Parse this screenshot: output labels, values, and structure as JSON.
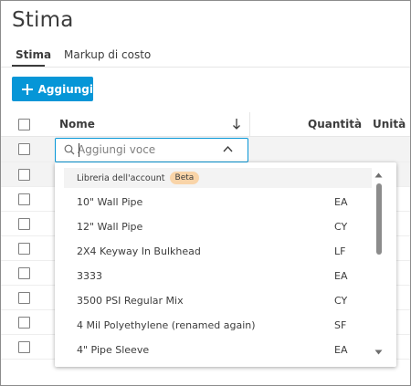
{
  "page": {
    "title": "Stima"
  },
  "tabs": [
    {
      "label": "Stima",
      "active": true
    },
    {
      "label": "Markup di costo",
      "active": false
    }
  ],
  "toolbar": {
    "add_label": "Aggiungi"
  },
  "table": {
    "columns": {
      "name": "Nome",
      "quantity": "Quantità",
      "unit": "Unità"
    }
  },
  "search": {
    "value": "",
    "placeholder": "Aggiungi voce"
  },
  "dropdown": {
    "group_label": "Libreria dell'account",
    "badge": "Beta",
    "items": [
      {
        "name": "10\" Wall Pipe",
        "unit": "EA"
      },
      {
        "name": "12\" Wall Pipe",
        "unit": "CY"
      },
      {
        "name": "2X4 Keyway In Bulkhead",
        "unit": "LF"
      },
      {
        "name": "3333",
        "unit": "EA"
      },
      {
        "name": "3500 PSI Regular Mix",
        "unit": "CY"
      },
      {
        "name": "4 Mil Polyethylene (renamed again)",
        "unit": "SF"
      },
      {
        "name": "4\" Pipe Sleeve",
        "unit": "EA"
      }
    ]
  },
  "colors": {
    "accent": "#0696d7",
    "badge": "#f9d4a8",
    "text": "#3c3c3c"
  },
  "icons": {
    "add": "plus-icon",
    "sort": "arrow-down-icon",
    "search": "search-icon",
    "collapse": "chevron-up-icon",
    "scroll_up": "scroll-up-icon",
    "scroll_down": "scroll-down-icon"
  }
}
